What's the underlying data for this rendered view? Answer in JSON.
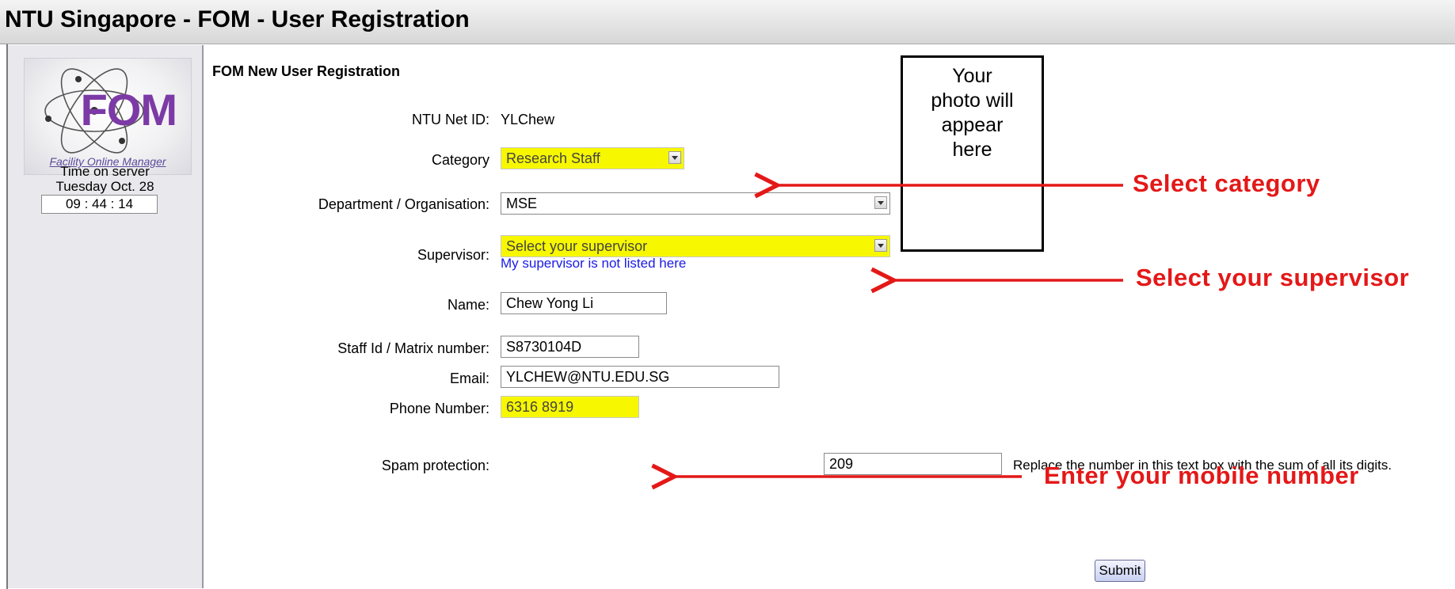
{
  "window": {
    "title": "NTU Singapore - FOM - User Registration"
  },
  "sidebar": {
    "logo_word": "FOM",
    "logo_tagline": "Facility Online Manager",
    "time_label": "Time on server",
    "date": "Tuesday Oct. 28",
    "clock": "09 : 44 : 14"
  },
  "form": {
    "heading": "FOM New User Registration",
    "net_id": {
      "label": "NTU Net ID:",
      "value": "YLChew"
    },
    "category": {
      "label": "Category",
      "value": "Research Staff"
    },
    "department": {
      "label": "Department / Organisation:",
      "value": "MSE"
    },
    "supervisor": {
      "label": "Supervisor:",
      "value": "Select your supervisor",
      "link": "My supervisor is not listed here"
    },
    "name": {
      "label": "Name:",
      "value": "Chew Yong Li"
    },
    "staff_id": {
      "label": "Staff Id / Matrix number:",
      "value": "S8730104D"
    },
    "email": {
      "label": "Email:",
      "value": "YLCHEW@NTU.EDU.SG"
    },
    "phone": {
      "label": "Phone Number:",
      "value": "6316 8919"
    },
    "spam": {
      "label": "Spam protection:",
      "value": "209",
      "hint": "Replace the number in this text box with the sum of all its digits."
    },
    "submit_label": "Submit"
  },
  "photo_box": {
    "lines": [
      "Your",
      "photo will",
      "appear",
      "here"
    ]
  },
  "annotations": {
    "category": "Select category",
    "supervisor": "Select your supervisor",
    "phone": "Enter your mobile number"
  },
  "colors": {
    "highlight": "#f7f700",
    "annotation": "#e41818",
    "link": "#1a1ae6"
  }
}
